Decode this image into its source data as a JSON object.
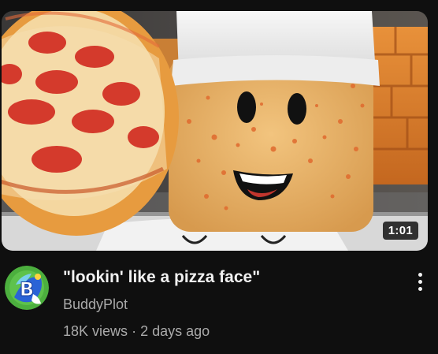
{
  "video": {
    "title": "\"lookin' like a pizza face\"",
    "channel": "BuddyPlot",
    "views": "18K views",
    "separator": "·",
    "age": "2 days ago",
    "duration": "1:01"
  },
  "icons": {
    "menu": "vertical-ellipsis-icon",
    "avatar": "channel-avatar"
  },
  "colors": {
    "background": "#0f0f0f",
    "title": "#f1f1f1",
    "secondary_text": "#aaaaaa"
  }
}
